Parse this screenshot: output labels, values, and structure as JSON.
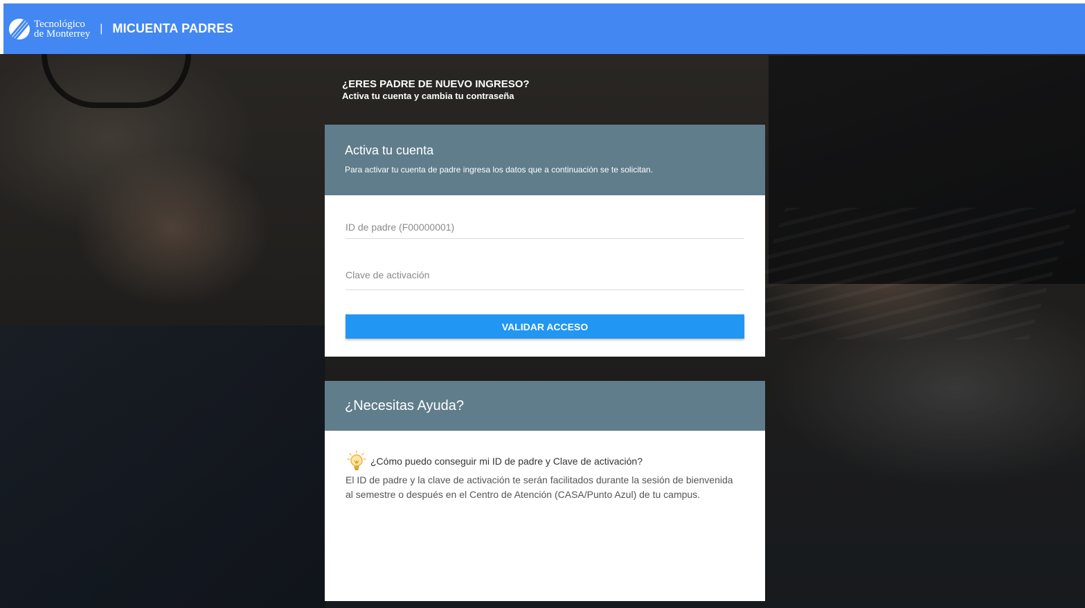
{
  "header": {
    "logo_line1": "Tecnológico",
    "logo_line2": "de Monterrey",
    "separator": "|",
    "app_title": "MICUENTA PADRES",
    "color": "#4387f3"
  },
  "intro": {
    "title": "¿ERES PADRE DE NUEVO INGRESO?",
    "subtitle": "Activa tu cuenta y cambia tu contraseña"
  },
  "activate_card": {
    "title": "Activa tu cuenta",
    "description": "Para activar tu cuenta de padre ingresa los datos que a continuación se te solicitan.",
    "id_field": {
      "placeholder": "ID de padre (F00000001)",
      "value": ""
    },
    "key_field": {
      "placeholder": "Clave de activación",
      "value": ""
    },
    "submit_label": "VALIDAR ACCESO",
    "head_color": "#607d8b",
    "button_color": "#2196f3"
  },
  "help_card": {
    "title": "¿Necesitas Ayuda?",
    "question": "¿Cómo puedo conseguir mi ID de padre y Clave de activación?",
    "answer": "El ID de padre y la clave de activación te serán facilitados durante la sesión de bienvenida al semestre o después en el Centro de Atención (CASA/Punto Azul) de tu campus.",
    "question_icon": "lightbulb-icon"
  }
}
